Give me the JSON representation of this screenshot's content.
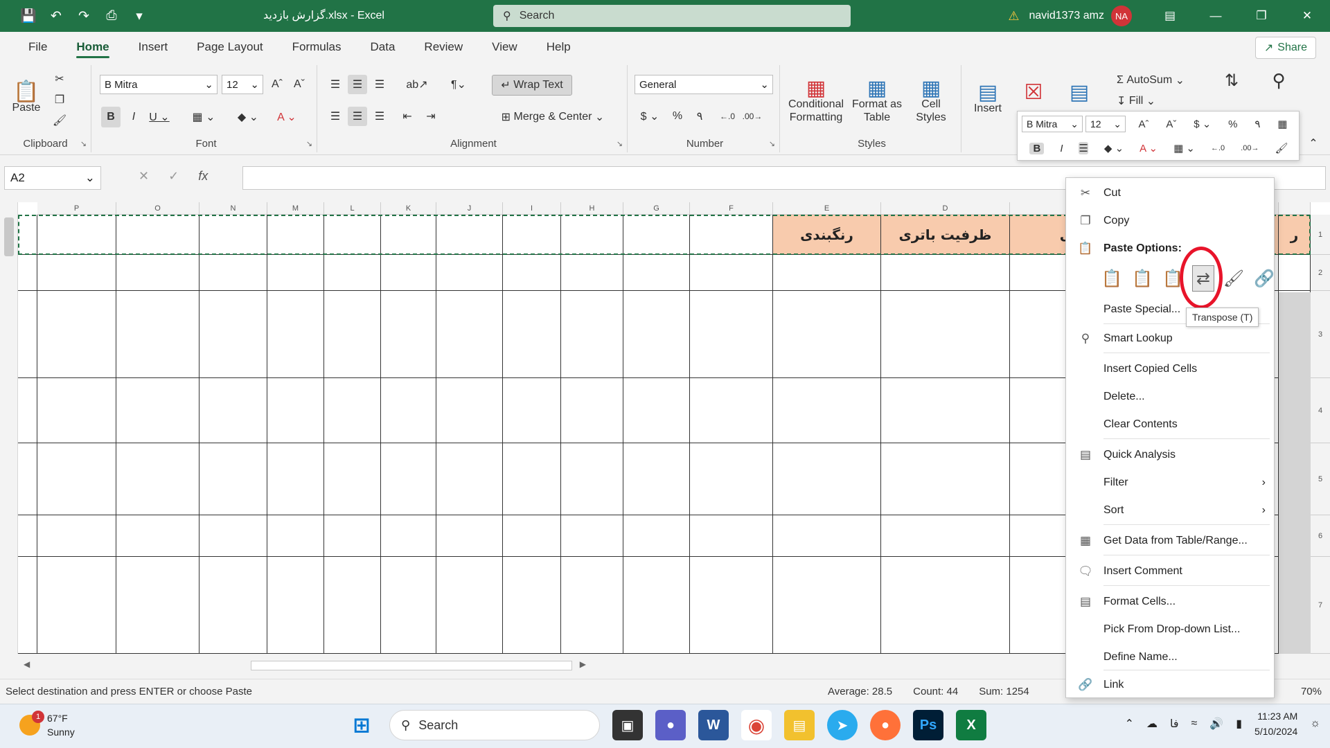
{
  "titlebar": {
    "title": "گزارش بازدید.xlsx  -  Excel",
    "search_placeholder": "Search",
    "user_name": "navid1373 amz",
    "avatar_initials": "NA"
  },
  "tabs": [
    "File",
    "Home",
    "Insert",
    "Page Layout",
    "Formulas",
    "Data",
    "Review",
    "View",
    "Help"
  ],
  "share_label": "Share",
  "ribbon": {
    "clipboard": {
      "label": "Clipboard",
      "paste": "Paste"
    },
    "font": {
      "label": "Font",
      "name": "B Mitra",
      "size": "12"
    },
    "alignment": {
      "label": "Alignment",
      "wrap": "Wrap Text",
      "merge": "Merge & Center"
    },
    "number": {
      "label": "Number",
      "format": "General"
    },
    "styles": {
      "label": "Styles",
      "conditional": "Conditional Formatting",
      "format_table": "Format as Table",
      "cell_styles": "Cell Styles"
    },
    "cells": {
      "insert": "Insert",
      "delete": "Delete",
      "format": "Format"
    },
    "editing": {
      "autosum": "AutoSum",
      "fill": "Fill",
      "sort": "Sort &",
      "find": "Find &"
    }
  },
  "formula_bar": {
    "name_box": "A2",
    "fx": "fx"
  },
  "columns": [
    "P",
    "O",
    "N",
    "M",
    "L",
    "K",
    "J",
    "I",
    "H",
    "G",
    "F",
    "E",
    "D"
  ],
  "header_cells": {
    "E": "رنگبندی",
    "D": "ظرفیت باتری",
    "C_partial": "ـشی",
    "B_partial": "ر"
  },
  "rows": [
    "1",
    "2",
    "3",
    "4",
    "5",
    "6",
    "7"
  ],
  "status": {
    "message": "Select destination and press ENTER or choose Paste",
    "average": "Average: 28.5",
    "count": "Count: 44",
    "sum": "Sum: 1254",
    "zoom": "70%"
  },
  "context_menu": {
    "cut": "Cut",
    "copy": "Copy",
    "paste_options": "Paste Options:",
    "paste_special": "Paste Special...",
    "smart_lookup": "Smart Lookup",
    "insert_copied": "Insert Copied Cells",
    "delete": "Delete...",
    "clear": "Clear Contents",
    "quick_analysis": "Quick Analysis",
    "filter": "Filter",
    "sort": "Sort",
    "get_data": "Get Data from Table/Range...",
    "insert_comment": "Insert Comment",
    "format_cells": "Format Cells...",
    "pick_list": "Pick From Drop-down List...",
    "define_name": "Define Name...",
    "link": "Link",
    "tooltip": "Transpose (T)"
  },
  "mini_toolbar": {
    "font": "B Mitra",
    "size": "12"
  },
  "taskbar": {
    "weather_temp": "67°F",
    "weather_desc": "Sunny",
    "weather_badge": "1",
    "search": "Search",
    "time": "11:23 AM",
    "date": "5/10/2024",
    "lang": "فا"
  }
}
